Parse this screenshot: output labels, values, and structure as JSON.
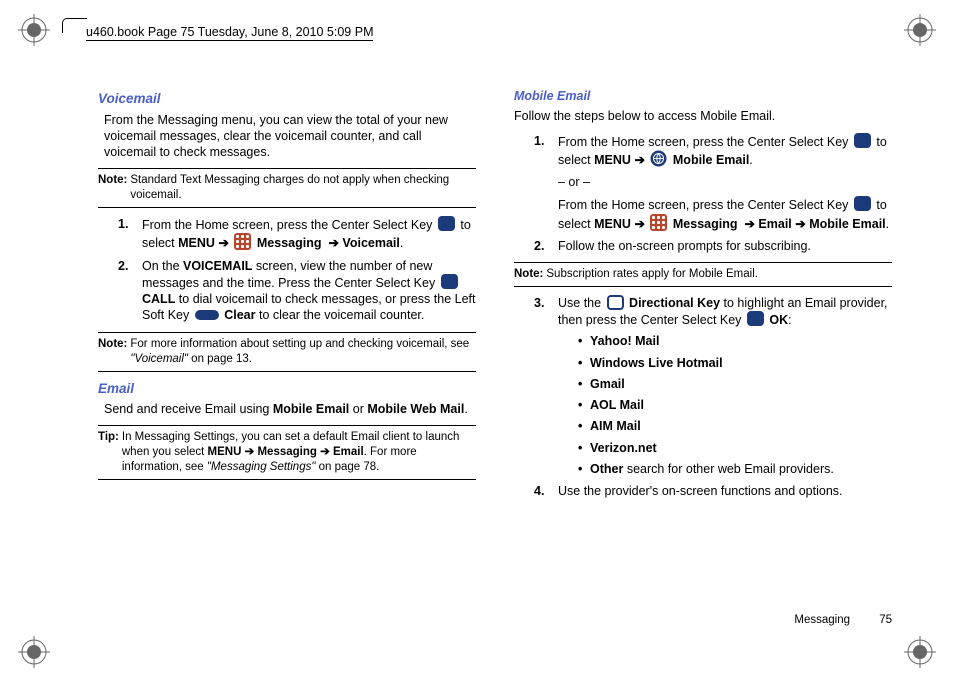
{
  "book_header": "u460.book  Page 75  Tuesday, June 8, 2010  5:09 PM",
  "left": {
    "h_voicemail": "Voicemail",
    "vm_intro": "From the Messaging menu, you can view the total of your new voicemail messages, clear the voicemail counter, and call voicemail to check messages.",
    "note1_label": "Note:",
    "note1_text": "Standard Text Messaging charges do not apply when checking voicemail.",
    "vm_step1_pre": "From the Home screen, press the Center Select Key ",
    "vm_step1_post1": " to select ",
    "menu_word": "MENU",
    "arrow": "➔",
    "messaging_word": "Messaging",
    "voicemail_word": "Voicemail",
    "vm_step2_a": "On the ",
    "voicemail_screen": "VOICEMAIL",
    "vm_step2_b": " screen, view the number of new messages and the time.  Press the Center Select Key ",
    "call_word": "CALL",
    "vm_step2_c": " to dial voicemail to check messages, or press the Left Soft Key ",
    "clear_word": "Clear",
    "vm_step2_d": " to clear the voicemail counter.",
    "note2_label": "Note:",
    "note2_text_a": "For more information about setting up and checking voicemail, see ",
    "note2_ref": "\"Voicemail\"",
    "note2_text_b": " on page 13.",
    "h_email": "Email",
    "email_intro_a": "Send and receive Email using ",
    "mobile_email": "Mobile Email",
    "email_intro_b": " or ",
    "mobile_web_mail": "Mobile Web Mail",
    "email_intro_c": ".",
    "tip_label": "Tip:",
    "tip_a": "In Messaging Settings, you can set a default Email client to launch when you select ",
    "email_word": "Email",
    "tip_b": ". For more information, see ",
    "tip_ref": "\"Messaging Settings\"",
    "tip_c": " on page 78."
  },
  "right": {
    "h_mobile_email": "Mobile Email",
    "me_intro": "Follow the steps below to access Mobile Email.",
    "me_step1_a": "From the Home screen, press the Center Select Key ",
    "me_step1_b": " to select ",
    "mobile_email_bold": "Mobile Email",
    "or": "– or –",
    "me_alt_a": "From the Home screen, press the Center Select Key ",
    "me_alt_b": " to select ",
    "me_step2": "Follow the on-screen prompts for subscribing.",
    "note3_label": "Note:",
    "note3_text": "Subscription rates apply for Mobile Email.",
    "me_step3_a": "Use the ",
    "dir_key": "Directional Key",
    "me_step3_b": " to highlight an Email provider, then press the Center Select Key ",
    "ok_word": "OK",
    "bullets": {
      "yahoo": "Yahoo! Mail",
      "wlh": "Windows Live Hotmail",
      "gmail": "Gmail",
      "aol": "AOL Mail",
      "aim": "AIM Mail",
      "vz": "Verizon.net",
      "other": "Other",
      "other_rest": " search for other web Email providers."
    },
    "me_step4": "Use the provider's on-screen functions and options."
  },
  "footer": {
    "section": "Messaging",
    "page": "75"
  }
}
